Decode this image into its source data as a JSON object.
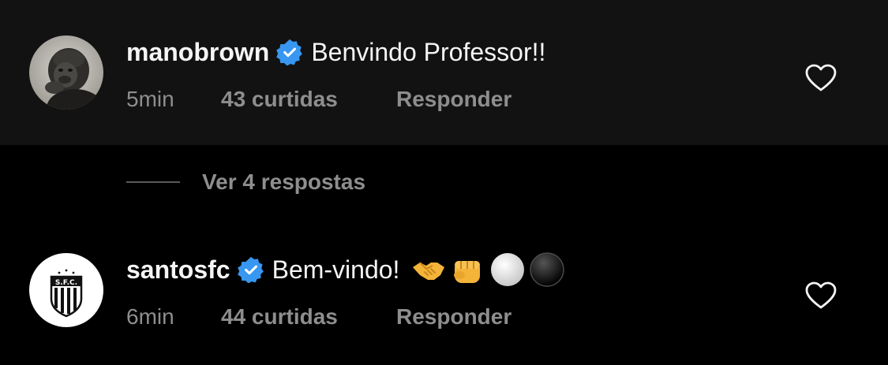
{
  "comments": [
    {
      "username": "manobrown",
      "verified": true,
      "text": "Benvindo Professor!!",
      "time": "5min",
      "likes": "43 curtidas",
      "reply_label": "Responder",
      "avatar_icon": "gorilla-avatar-icon"
    },
    {
      "username": "santosfc",
      "verified": true,
      "text": "Bem-vindo!",
      "emojis": [
        "handshake-emoji",
        "fist-emoji",
        "white-circle-emoji",
        "black-circle-emoji"
      ],
      "time": "6min",
      "likes": "44 curtidas",
      "reply_label": "Responder",
      "avatar_icon": "santos-fc-crest-icon"
    }
  ],
  "view_replies": {
    "label": "Ver 4 respostas"
  },
  "colors": {
    "background": "#000000",
    "highlight_background": "#121212",
    "primary_text": "#f5f5f5",
    "secondary_text": "#8e8e8e",
    "verified_badge": "#3897f0"
  }
}
